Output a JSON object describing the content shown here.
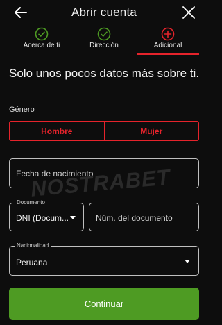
{
  "header": {
    "title": "Abrir cuenta",
    "back_icon": "arrow-left-icon",
    "close_icon": "close-icon"
  },
  "steps": [
    {
      "label": "Acerca de ti",
      "status": "complete",
      "icon": "check-circle-icon",
      "color": "#4e9b23"
    },
    {
      "label": "Dirección",
      "status": "complete",
      "icon": "check-circle-icon",
      "color": "#4e9b23"
    },
    {
      "label": "Adicional",
      "status": "active",
      "icon": "plus-circle-icon",
      "color": "#e5232b"
    }
  ],
  "heading": "Solo unos pocos datos más sobre ti.",
  "gender": {
    "label": "Género",
    "options": [
      "Hombre",
      "Mujer"
    ]
  },
  "birth_date": {
    "placeholder": "Fecha de nacimiento"
  },
  "document": {
    "type_label": "Documento",
    "type_value": "DNI (Docum...",
    "number_placeholder": "Núm. del documento"
  },
  "nationality": {
    "label": "Nacionalidad",
    "value": "Peruana"
  },
  "continue_label": "Continuar",
  "watermark": "NOSTRABET",
  "colors": {
    "accent_red": "#e5232b",
    "accent_green": "#4e9b23",
    "background": "#0d0d0d"
  }
}
